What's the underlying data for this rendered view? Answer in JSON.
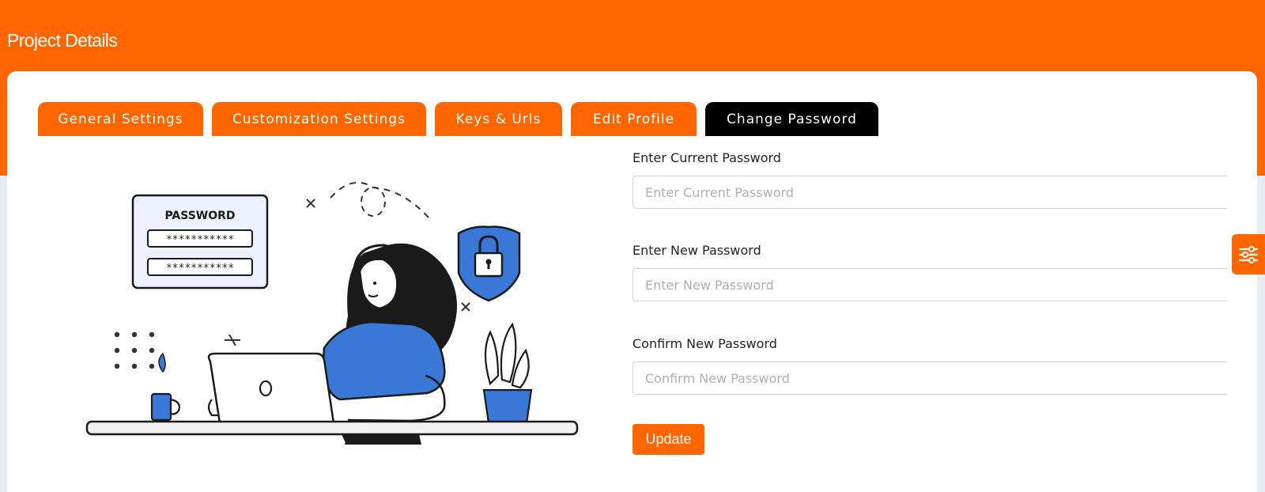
{
  "header": {
    "title": "Project Details"
  },
  "tabs": [
    {
      "label": "General Settings",
      "active": false
    },
    {
      "label": "Customization Settings",
      "active": false
    },
    {
      "label": "Keys & Urls",
      "active": false
    },
    {
      "label": "Edit Profile",
      "active": false
    },
    {
      "label": "Change Password",
      "active": true
    }
  ],
  "form": {
    "current": {
      "label": "Enter Current Password",
      "placeholder": "Enter Current Password",
      "value": ""
    },
    "new": {
      "label": "Enter New Password",
      "placeholder": "Enter New Password",
      "value": ""
    },
    "confirm": {
      "label": "Confirm New Password",
      "placeholder": "Confirm New Password",
      "value": ""
    },
    "submit_label": "Update"
  },
  "illustration": {
    "card_title": "PASSWORD",
    "masked_1": "***********",
    "masked_2": "***********"
  },
  "side_panel": {
    "icon": "sliders-icon"
  },
  "colors": {
    "brand": "#ff6600",
    "active_tab": "#000000",
    "illustration_blue": "#3a78d8"
  }
}
